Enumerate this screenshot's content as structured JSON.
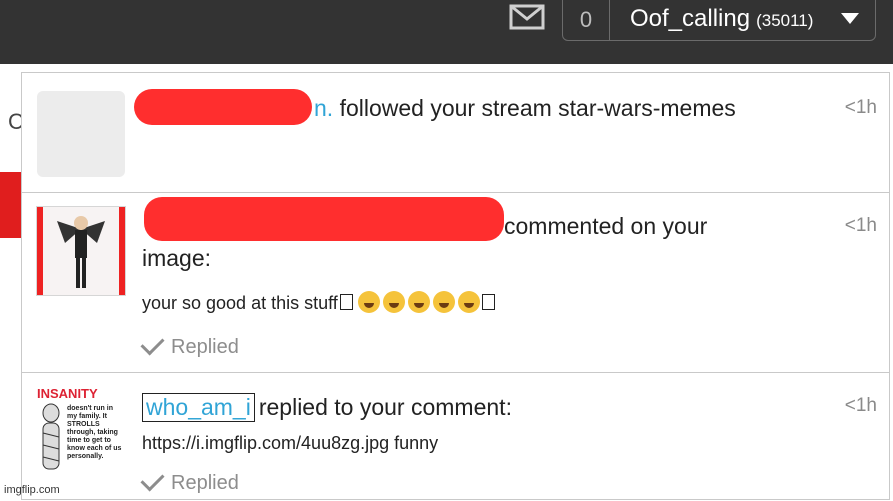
{
  "header": {
    "mail_icon": "envelope-icon",
    "notification_count": "0",
    "username": "Oof_calling",
    "points": "(35011)"
  },
  "background": {
    "partial_letter": "C"
  },
  "notifications": [
    {
      "user_suffix": "n.",
      "text": " followed your stream star-wars-memes",
      "time": "<1h"
    },
    {
      "text_line1": "commented on your",
      "text_line2": "image:",
      "comment": "your so good at this stuff",
      "status": "Replied",
      "time": "<1h"
    },
    {
      "user": "who_am_i",
      "text": "replied to your comment:",
      "comment": "https://i.imgflip.com/4uu8zg.jpg funny",
      "status": "Replied",
      "time": "<1h",
      "thumb_title": "INSANITY",
      "thumb_text": "doesn't run in my family. It STROLLS through, taking time to get to know each of us personally."
    }
  ],
  "watermark": "imgflip.com"
}
